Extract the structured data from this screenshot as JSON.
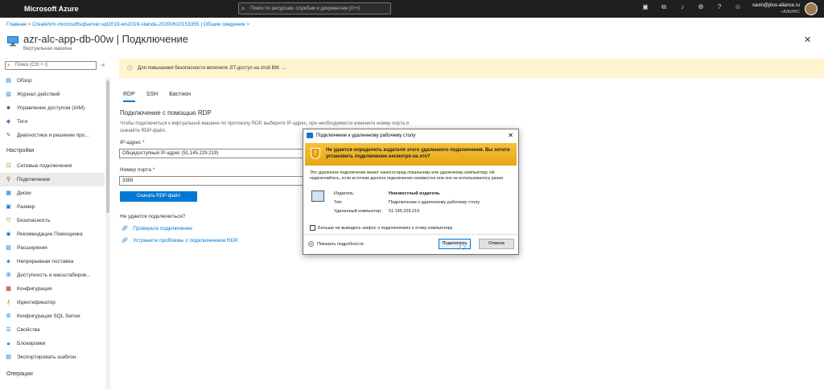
{
  "topbar": {
    "brand": "Microsoft Azure",
    "search_placeholder": "Поиск по ресурсам, службам и документам (G+/)",
    "account_email": "savin@plus-aliance.ru",
    "account_tenant": "+АЛЬЯНС"
  },
  "breadcrumb": {
    "home": "Главная",
    "resource": "CreateVm-microsoftsqlserver.sql2019-ws2019-standa-20200610153355 | Общие сведения"
  },
  "header": {
    "title": "azr-alc-app-db-00w | Подключение",
    "subtitle": "Виртуальная машина",
    "close_glyph": "✕"
  },
  "sidebar": {
    "search_placeholder": "Поиск (Ctrl + /)",
    "collapse_glyph": "«",
    "items_top": [
      {
        "icon": "overview-icon",
        "label": "Обзор"
      },
      {
        "icon": "activity-log-icon",
        "label": "Журнал действий"
      },
      {
        "icon": "iam-icon",
        "label": "Управление доступом (IAM)"
      },
      {
        "icon": "tag-icon",
        "label": "Теги"
      },
      {
        "icon": "diagnose-icon",
        "label": "Диагностика и решение про..."
      }
    ],
    "section_settings": "Настройки",
    "items_settings": [
      {
        "icon": "network-icon",
        "label": "Сетевые подключения"
      },
      {
        "icon": "connect-icon",
        "label": "Подключение"
      },
      {
        "icon": "disk-icon",
        "label": "Диски"
      },
      {
        "icon": "size-icon",
        "label": "Размер"
      },
      {
        "icon": "security-icon",
        "label": "Безопасность"
      },
      {
        "icon": "advisor-icon",
        "label": "Рекомендации Помощника"
      },
      {
        "icon": "extensions-icon",
        "label": "Расширения"
      },
      {
        "icon": "delivery-icon",
        "label": "Непрерывная поставка"
      },
      {
        "icon": "availability-icon",
        "label": "Доступность и масштабиров..."
      },
      {
        "icon": "config-icon",
        "label": "Конфигурация"
      },
      {
        "icon": "identity-icon",
        "label": "Идентификатор"
      },
      {
        "icon": "sql-icon",
        "label": "Конфигурация SQL Server"
      },
      {
        "icon": "properties-icon",
        "label": "Свойства"
      },
      {
        "icon": "lock-icon",
        "label": "Блокировки"
      },
      {
        "icon": "template-icon",
        "label": "Экспортировать шаблон"
      }
    ],
    "section_operations": "Операции"
  },
  "banner": {
    "text": "Для повышения безопасности включите JIT-доступ на этой ВМ. →"
  },
  "tabs": [
    "RDP",
    "SSH",
    "Бастион"
  ],
  "main": {
    "heading": "Подключение с помощью RDP",
    "description": "Чтобы подключиться к виртуальной машине по протоколу RDP, выберите IP-адрес, при необходимости измените номер порта и скачайте RDP-файл.",
    "ip_label": "IP-адрес *",
    "ip_value": "Общедоступный IP-адрес (51.145.229.219)",
    "port_label": "Номер порта *",
    "port_value": "3389",
    "download_button": "Скачать RDP-файл",
    "cant_connect": "Не удается подключиться?",
    "link_check": "Проверьте подключение",
    "link_troubleshoot": "Устраните проблемы с подключением RDP."
  },
  "dialog": {
    "title": "Подключение к удаленному рабочему столу",
    "warning": "Не удается определить издателя этого удаленного подключения. Вы хотите установить подключение несмотря на это?",
    "body": "Это удаленное подключение может нанести вред локальному или удаленному компьютеру. Не подключайтесь, если источник данного подключения неизвестен или оно не использовалось ранее.",
    "publisher_label": "Издатель:",
    "publisher_value": "Неизвестный издатель",
    "type_label": "Тип:",
    "type_value": "Подключение к удаленному рабочему столу",
    "remote_label": "Удаленный компьютер:",
    "remote_value": "51.145.229.219",
    "checkbox_label": "Больше не выводить запрос о подключениях к этому компьютеру",
    "details_label": "Показать подробности",
    "connect_button": "Подключить",
    "cancel_button": "Отмена"
  }
}
